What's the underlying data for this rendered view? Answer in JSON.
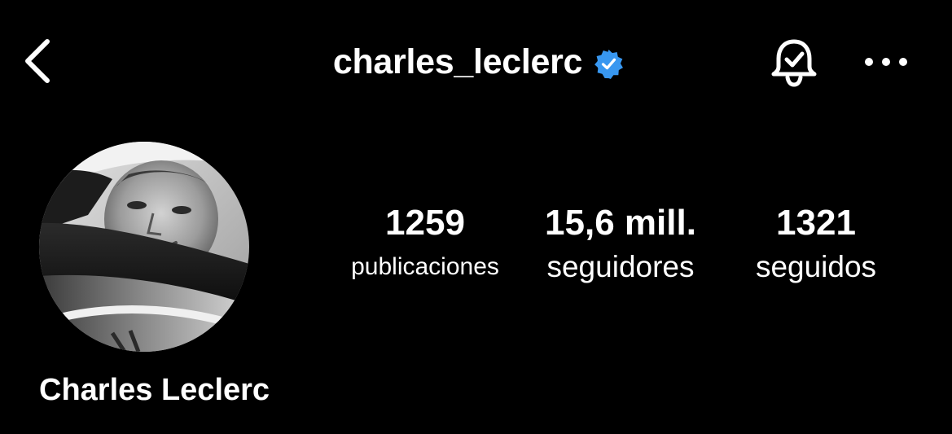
{
  "header": {
    "username": "charles_leclerc",
    "verified": true,
    "back_icon": "chevron-left-icon",
    "notification_icon": "bell-check-icon",
    "more_icon": "ellipsis-icon",
    "verified_color": "#3897F0"
  },
  "profile": {
    "display_name": "Charles Leclerc",
    "avatar_icon": "profile-photo"
  },
  "stats": {
    "posts": {
      "value": "1259",
      "label": "publicaciones"
    },
    "followers": {
      "value": "15,6 mill.",
      "label": "seguidores"
    },
    "following": {
      "value": "1321",
      "label": "seguidos"
    }
  },
  "colors": {
    "background": "#000000",
    "text": "#FFFFFF"
  }
}
